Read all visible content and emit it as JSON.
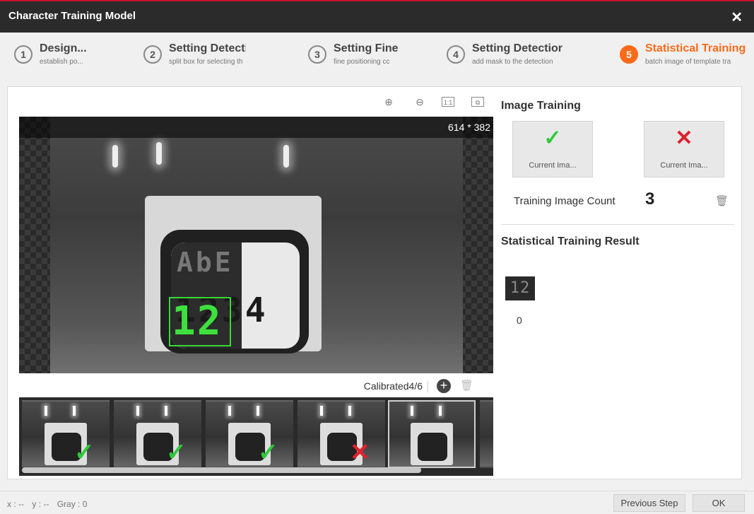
{
  "window": {
    "title": "Character Training Model",
    "close_glyph": "✕"
  },
  "steps": [
    {
      "num": "1",
      "title": "Design...",
      "subtitle": "establish po..."
    },
    {
      "num": "2",
      "title": "Setting Detecti",
      "subtitle": "split box for selecting th"
    },
    {
      "num": "3",
      "title": "Setting Fine",
      "subtitle": "fine positioning cc"
    },
    {
      "num": "4",
      "title": "Setting Detectior",
      "subtitle": "add mask to the detection"
    },
    {
      "num": "5",
      "title": "Statistical Training",
      "subtitle": "batch image of template tra"
    }
  ],
  "toolbar": {
    "zoom_in_glyph": "⊕",
    "zoom_out_glyph": "⊖",
    "actual_size_label": "1:1",
    "fit_glyph": "⧉"
  },
  "viewer": {
    "dimensions": "614 * 382",
    "top_chars": "AbE",
    "bottom_chars": "1234",
    "roi_chars": "12"
  },
  "strip": {
    "calibrated": "Calibrated4/6",
    "add_glyph": "+",
    "delete_glyph": "🗑",
    "thumbnails": [
      {
        "status": "ok",
        "glyph": "✓"
      },
      {
        "status": "ok",
        "glyph": "✓"
      },
      {
        "status": "ok",
        "glyph": "✓"
      },
      {
        "status": "bad",
        "glyph": "✕"
      },
      {
        "status": "selected",
        "glyph": ""
      }
    ]
  },
  "image_training": {
    "title": "Image Training",
    "ok_button": {
      "glyph": "✓",
      "label": "Current Ima..."
    },
    "ng_button": {
      "glyph": "✕",
      "label": "Current Ima..."
    },
    "count_label": "Training Image Count",
    "count_value": "3",
    "trash_glyph": "🗑"
  },
  "statistical_result": {
    "title": "Statistical Training Result",
    "thumb_chars": "12",
    "value": "0"
  },
  "statusbar": {
    "x": "x : --",
    "y": "y : --",
    "gray": "Gray : 0",
    "previous_label": "Previous Step",
    "ok_label": "OK"
  },
  "colors": {
    "accent": "#ff6a1a",
    "ok": "#2fc93a",
    "ng": "#e0202c",
    "roi": "#38d838",
    "title_bar": "#2b2b2b"
  }
}
